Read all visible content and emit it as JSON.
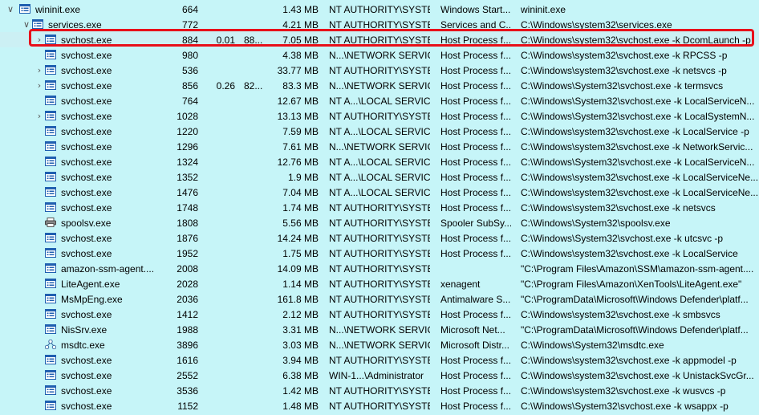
{
  "processes": [
    {
      "name": "wininit.exe",
      "pid": "664",
      "cpu": "",
      "ws": "",
      "mem": "1.43 MB",
      "user": "NT AUTHORITY\\SYSTEM",
      "desc": "Windows Start...",
      "cmd": "wininit.exe",
      "icon": "window-icon",
      "level": 0,
      "expander": "expanded",
      "selected": false
    },
    {
      "name": "services.exe",
      "pid": "772",
      "cpu": "",
      "ws": "",
      "mem": "4.21 MB",
      "user": "NT AUTHORITY\\SYSTEM",
      "desc": "Services and C...",
      "cmd": "C:\\Windows\\system32\\services.exe",
      "icon": "window-icon",
      "level": 1,
      "expander": "expanded",
      "selected": false
    },
    {
      "name": "svchost.exe",
      "pid": "884",
      "cpu": "0.01",
      "ws": "88...",
      "mem": "7.05 MB",
      "user": "NT AUTHORITY\\SYSTEM",
      "desc": "Host Process f...",
      "cmd": "C:\\Windows\\system32\\svchost.exe -k DcomLaunch -p",
      "icon": "window-icon",
      "level": 2,
      "expander": "collapsed",
      "selected": true
    },
    {
      "name": "svchost.exe",
      "pid": "980",
      "cpu": "",
      "ws": "",
      "mem": "4.38 MB",
      "user": "N...\\NETWORK SERVICE",
      "desc": "Host Process f...",
      "cmd": "C:\\Windows\\system32\\svchost.exe -k RPCSS -p",
      "icon": "window-icon",
      "level": 2,
      "expander": "none",
      "selected": false
    },
    {
      "name": "svchost.exe",
      "pid": "536",
      "cpu": "",
      "ws": "",
      "mem": "33.77 MB",
      "user": "NT AUTHORITY\\SYSTEM",
      "desc": "Host Process f...",
      "cmd": "C:\\Windows\\system32\\svchost.exe -k netsvcs -p",
      "icon": "window-icon",
      "level": 2,
      "expander": "collapsed",
      "selected": false
    },
    {
      "name": "svchost.exe",
      "pid": "856",
      "cpu": "0.26",
      "ws": "82...",
      "mem": "83.3 MB",
      "user": "N...\\NETWORK SERVICE",
      "desc": "Host Process f...",
      "cmd": "C:\\Windows\\System32\\svchost.exe -k termsvcs",
      "icon": "window-icon",
      "level": 2,
      "expander": "collapsed",
      "selected": false
    },
    {
      "name": "svchost.exe",
      "pid": "764",
      "cpu": "",
      "ws": "",
      "mem": "12.67 MB",
      "user": "NT A...\\LOCAL SERVICE",
      "desc": "Host Process f...",
      "cmd": "C:\\Windows\\System32\\svchost.exe -k LocalServiceN...",
      "icon": "window-icon",
      "level": 2,
      "expander": "none",
      "selected": false
    },
    {
      "name": "svchost.exe",
      "pid": "1028",
      "cpu": "",
      "ws": "",
      "mem": "13.13 MB",
      "user": "NT AUTHORITY\\SYSTEM",
      "desc": "Host Process f...",
      "cmd": "C:\\Windows\\System32\\svchost.exe -k LocalSystemN...",
      "icon": "window-icon",
      "level": 2,
      "expander": "collapsed",
      "selected": false
    },
    {
      "name": "svchost.exe",
      "pid": "1220",
      "cpu": "",
      "ws": "",
      "mem": "7.59 MB",
      "user": "NT A...\\LOCAL SERVICE",
      "desc": "Host Process f...",
      "cmd": "C:\\Windows\\system32\\svchost.exe -k LocalService -p",
      "icon": "window-icon",
      "level": 2,
      "expander": "none",
      "selected": false
    },
    {
      "name": "svchost.exe",
      "pid": "1296",
      "cpu": "",
      "ws": "",
      "mem": "7.61 MB",
      "user": "N...\\NETWORK SERVICE",
      "desc": "Host Process f...",
      "cmd": "C:\\Windows\\system32\\svchost.exe -k NetworkServic...",
      "icon": "window-icon",
      "level": 2,
      "expander": "none",
      "selected": false
    },
    {
      "name": "svchost.exe",
      "pid": "1324",
      "cpu": "",
      "ws": "",
      "mem": "12.76 MB",
      "user": "NT A...\\LOCAL SERVICE",
      "desc": "Host Process f...",
      "cmd": "C:\\Windows\\System32\\svchost.exe -k LocalServiceN...",
      "icon": "window-icon",
      "level": 2,
      "expander": "none",
      "selected": false
    },
    {
      "name": "svchost.exe",
      "pid": "1352",
      "cpu": "",
      "ws": "",
      "mem": "1.9 MB",
      "user": "NT A...\\LOCAL SERVICE",
      "desc": "Host Process f...",
      "cmd": "C:\\Windows\\system32\\svchost.exe -k LocalServiceNe...",
      "icon": "window-icon",
      "level": 2,
      "expander": "none",
      "selected": false
    },
    {
      "name": "svchost.exe",
      "pid": "1476",
      "cpu": "",
      "ws": "",
      "mem": "7.04 MB",
      "user": "NT A...\\LOCAL SERVICE",
      "desc": "Host Process f...",
      "cmd": "C:\\Windows\\system32\\svchost.exe -k LocalServiceNe...",
      "icon": "window-icon",
      "level": 2,
      "expander": "none",
      "selected": false
    },
    {
      "name": "svchost.exe",
      "pid": "1748",
      "cpu": "",
      "ws": "",
      "mem": "1.74 MB",
      "user": "NT AUTHORITY\\SYSTEM",
      "desc": "Host Process f...",
      "cmd": "C:\\Windows\\system32\\svchost.exe -k netsvcs",
      "icon": "window-icon",
      "level": 2,
      "expander": "none",
      "selected": false
    },
    {
      "name": "spoolsv.exe",
      "pid": "1808",
      "cpu": "",
      "ws": "",
      "mem": "5.56 MB",
      "user": "NT AUTHORITY\\SYSTEM",
      "desc": "Spooler SubSy...",
      "cmd": "C:\\Windows\\System32\\spoolsv.exe",
      "icon": "printer-icon",
      "level": 2,
      "expander": "none",
      "selected": false
    },
    {
      "name": "svchost.exe",
      "pid": "1876",
      "cpu": "",
      "ws": "",
      "mem": "14.24 MB",
      "user": "NT AUTHORITY\\SYSTEM",
      "desc": "Host Process f...",
      "cmd": "C:\\Windows\\System32\\svchost.exe -k utcsvc -p",
      "icon": "window-icon",
      "level": 2,
      "expander": "none",
      "selected": false
    },
    {
      "name": "svchost.exe",
      "pid": "1952",
      "cpu": "",
      "ws": "",
      "mem": "1.75 MB",
      "user": "NT AUTHORITY\\SYSTEM",
      "desc": "Host Process f...",
      "cmd": "C:\\Windows\\system32\\svchost.exe -k LocalService",
      "icon": "window-icon",
      "level": 2,
      "expander": "none",
      "selected": false
    },
    {
      "name": "amazon-ssm-agent....",
      "pid": "2008",
      "cpu": "",
      "ws": "",
      "mem": "14.09 MB",
      "user": "NT AUTHORITY\\SYSTEM",
      "desc": "",
      "cmd": "\"C:\\Program Files\\Amazon\\SSM\\amazon-ssm-agent....",
      "icon": "window-icon",
      "level": 2,
      "expander": "none",
      "selected": false
    },
    {
      "name": "LiteAgent.exe",
      "pid": "2028",
      "cpu": "",
      "ws": "",
      "mem": "1.14 MB",
      "user": "NT AUTHORITY\\SYSTEM",
      "desc": "xenagent",
      "cmd": "\"C:\\Program Files\\Amazon\\XenTools\\LiteAgent.exe\"",
      "icon": "window-icon",
      "level": 2,
      "expander": "none",
      "selected": false
    },
    {
      "name": "MsMpEng.exe",
      "pid": "2036",
      "cpu": "",
      "ws": "",
      "mem": "161.8 MB",
      "user": "NT AUTHORITY\\SYSTEM",
      "desc": "Antimalware S...",
      "cmd": "\"C:\\ProgramData\\Microsoft\\Windows Defender\\platf...",
      "icon": "window-icon",
      "level": 2,
      "expander": "none",
      "selected": false
    },
    {
      "name": "svchost.exe",
      "pid": "1412",
      "cpu": "",
      "ws": "",
      "mem": "2.12 MB",
      "user": "NT AUTHORITY\\SYSTEM",
      "desc": "Host Process f...",
      "cmd": "C:\\Windows\\system32\\svchost.exe -k smbsvcs",
      "icon": "window-icon",
      "level": 2,
      "expander": "none",
      "selected": false
    },
    {
      "name": "NisSrv.exe",
      "pid": "1988",
      "cpu": "",
      "ws": "",
      "mem": "3.31 MB",
      "user": "N...\\NETWORK SERVICE",
      "desc": "Microsoft Net...",
      "cmd": "\"C:\\ProgramData\\Microsoft\\Windows Defender\\platf...",
      "icon": "window-icon",
      "level": 2,
      "expander": "none",
      "selected": false
    },
    {
      "name": "msdtc.exe",
      "pid": "3896",
      "cpu": "",
      "ws": "",
      "mem": "3.03 MB",
      "user": "N...\\NETWORK SERVICE",
      "desc": "Microsoft Distr...",
      "cmd": "C:\\Windows\\System32\\msdtc.exe",
      "icon": "network-icon",
      "level": 2,
      "expander": "none",
      "selected": false
    },
    {
      "name": "svchost.exe",
      "pid": "1616",
      "cpu": "",
      "ws": "",
      "mem": "3.94 MB",
      "user": "NT AUTHORITY\\SYSTEM",
      "desc": "Host Process f...",
      "cmd": "C:\\Windows\\system32\\svchost.exe -k appmodel -p",
      "icon": "window-icon",
      "level": 2,
      "expander": "none",
      "selected": false
    },
    {
      "name": "svchost.exe",
      "pid": "2552",
      "cpu": "",
      "ws": "",
      "mem": "6.38 MB",
      "user": "WIN-1...\\Administrator",
      "desc": "Host Process f...",
      "cmd": "C:\\Windows\\system32\\svchost.exe -k UnistackSvcGr...",
      "icon": "window-icon",
      "level": 2,
      "expander": "none",
      "selected": false
    },
    {
      "name": "svchost.exe",
      "pid": "3536",
      "cpu": "",
      "ws": "",
      "mem": "1.42 MB",
      "user": "NT AUTHORITY\\SYSTEM",
      "desc": "Host Process f...",
      "cmd": "C:\\Windows\\system32\\svchost.exe -k wusvcs -p",
      "icon": "window-icon",
      "level": 2,
      "expander": "none",
      "selected": false
    },
    {
      "name": "svchost.exe",
      "pid": "1152",
      "cpu": "",
      "ws": "",
      "mem": "1.48 MB",
      "user": "NT AUTHORITY\\SYSTEM",
      "desc": "Host Process f...",
      "cmd": "C:\\Windows\\System32\\svchost.exe -k wsappx -p",
      "icon": "window-icon",
      "level": 2,
      "expander": "none",
      "selected": false
    }
  ],
  "colors": {
    "background": "#c6f5f8",
    "highlight_border": "#e8101a",
    "icon_blue": "#1f5fb0"
  }
}
